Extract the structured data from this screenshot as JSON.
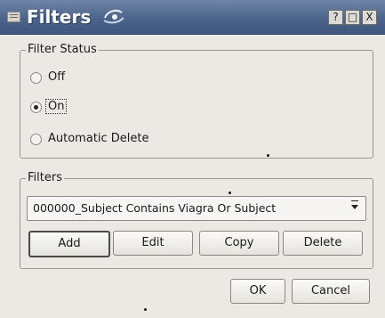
{
  "window": {
    "title": "Filters",
    "help_button": "?",
    "maximize_button": "□",
    "close_button": "X"
  },
  "filter_status": {
    "legend": "Filter Status",
    "options": [
      {
        "label": "Off",
        "checked": false
      },
      {
        "label": "On",
        "checked": true
      },
      {
        "label": "Automatic Delete",
        "checked": false
      }
    ]
  },
  "filters": {
    "legend": "Filters",
    "selected_filter": "000000_Subject Contains Viagra Or Subject",
    "buttons": {
      "add": "Add",
      "edit": "Edit",
      "copy": "Copy",
      "delete": "Delete"
    }
  },
  "dialog_buttons": {
    "ok": "OK",
    "cancel": "Cancel"
  }
}
